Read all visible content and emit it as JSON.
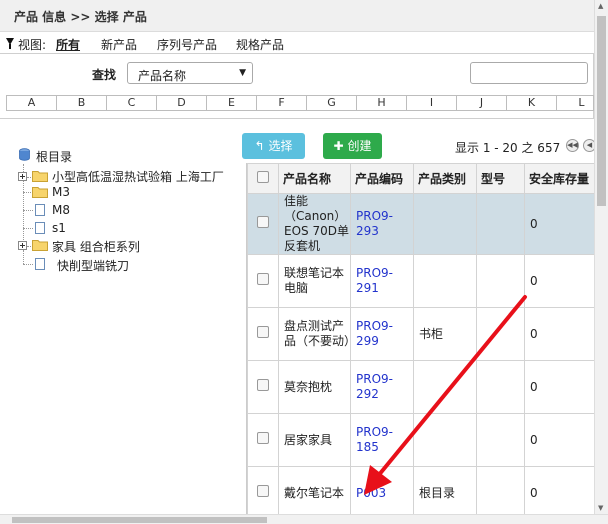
{
  "header": {
    "breadcrumb": "产品 信息 >> 选择 产品"
  },
  "views": {
    "label": "视图:",
    "items": [
      "所有",
      "新产品",
      "序列号产品",
      "规格产品"
    ],
    "active": "所有"
  },
  "search": {
    "label": "查找",
    "field_value": "产品名称",
    "input_value": ""
  },
  "alphabet": [
    "A",
    "B",
    "C",
    "D",
    "E",
    "F",
    "G",
    "H",
    "I",
    "J",
    "K",
    "L"
  ],
  "tree": {
    "root": "根目录",
    "nodes": [
      "小型高低温湿热试验箱 上海工厂",
      "M3",
      "M8",
      "s1",
      "家具 组合柜系列",
      "快削型端铣刀"
    ]
  },
  "actions": {
    "select_label": "选择",
    "create_label": "创建"
  },
  "pager": {
    "text": "显示 1 - 20 之 657"
  },
  "table": {
    "columns": [
      "产品名称",
      "产品编码",
      "产品类别",
      "型号",
      "安全库存量"
    ],
    "rows": [
      {
        "name": "佳能（Canon）EOS 70D单反套机",
        "code": "PRO9-293",
        "category": "",
        "model": "",
        "stock": "0"
      },
      {
        "name": "联想笔记本电脑",
        "code": "PRO9-291",
        "category": "",
        "model": "",
        "stock": "0"
      },
      {
        "name": "盘点测试产品（不要动）",
        "code": "PRO9-299",
        "category": "书柜",
        "model": "",
        "stock": "0"
      },
      {
        "name": "莫奈抱枕",
        "code": "PRO9-292",
        "category": "",
        "model": "",
        "stock": "0"
      },
      {
        "name": "居家家具",
        "code": "PRO9-185",
        "category": "",
        "model": "",
        "stock": "0"
      },
      {
        "name": "戴尔笔记本",
        "code": "P003",
        "category": "根目录",
        "model": "",
        "stock": "0"
      }
    ]
  },
  "colors": {
    "select_button": "#5bc0de",
    "create_button": "#2eaa4b",
    "selected_row": "#cfdde5",
    "annotation_arrow": "#e8101a",
    "link": "#2233cc"
  }
}
